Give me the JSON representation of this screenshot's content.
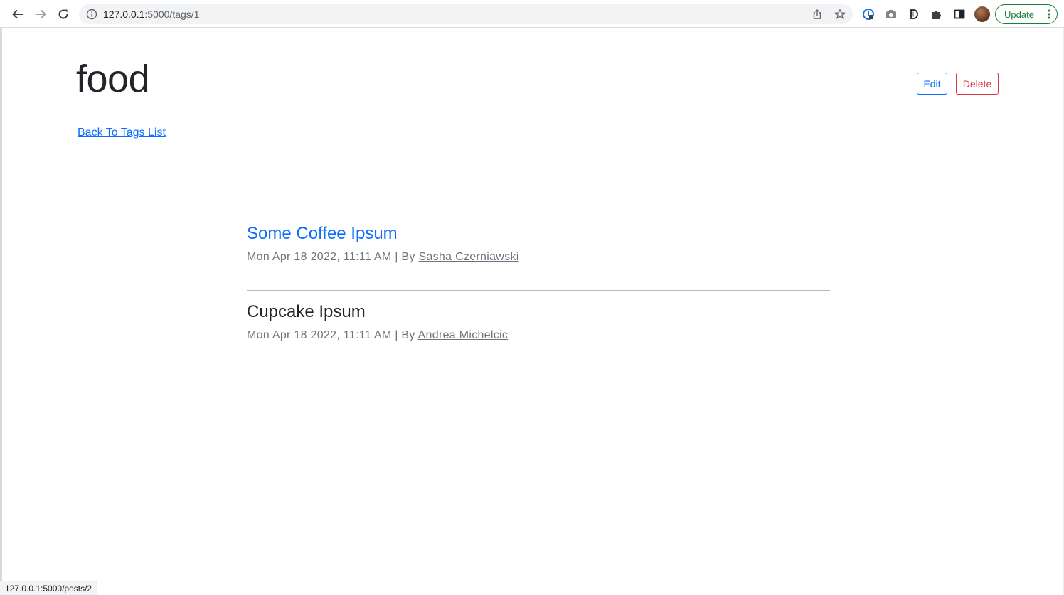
{
  "browser": {
    "url_host": "127.0.0.1",
    "url_path": ":5000/tags/1",
    "update_label": "Update"
  },
  "page": {
    "title": "food",
    "edit_label": "Edit",
    "delete_label": "Delete",
    "back_link": "Back To Tags List"
  },
  "posts": [
    {
      "title": "Some Coffee Ipsum",
      "date": "Mon Apr 18 2022, 11:11 AM",
      "by": " | By ",
      "author": "Sasha Czerniawski"
    },
    {
      "title": "Cupcake Ipsum",
      "date": "Mon Apr 18 2022, 11:11 AM",
      "by": " | By ",
      "author": "Andrea Michelcic"
    }
  ],
  "status_bar": {
    "url": "127.0.0.1:5000/posts/2"
  },
  "colors": {
    "link": "#0d6efd",
    "danger": "#dc3545",
    "update_green": "#188038"
  }
}
